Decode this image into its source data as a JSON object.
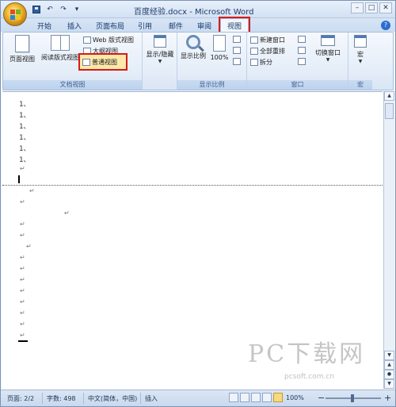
{
  "window": {
    "title": "百度经验.docx - Microsoft Word",
    "controls": [
      "–",
      "□",
      "✕"
    ]
  },
  "qat": {
    "icons": [
      "save-icon",
      "undo-icon",
      "redo-icon",
      "customize-icon"
    ],
    "undo_glyph": "↶",
    "redo_glyph": "↷",
    "more_glyph": "▾"
  },
  "tabs": [
    "开始",
    "插入",
    "页面布局",
    "引用",
    "邮件",
    "审阅",
    "视图"
  ],
  "active_tab": "视图",
  "accent": {
    "highlight_red": "#d81a1a",
    "ribbon_blue": "#c9dbf1"
  },
  "ribbon": {
    "doc_views": {
      "label": "文档视图",
      "page_view": "页面视图",
      "reading_view": "阅读版式视图",
      "web_view": "Web 版式视图",
      "outline_view": "大纲视图",
      "normal_view": "普通视图"
    },
    "show_hide": {
      "label": "显示/隐藏"
    },
    "zoom": {
      "label": "显示比例",
      "zoom_btn": "显示比例",
      "zoom_100": "100%"
    },
    "window": {
      "label": "窗口",
      "new_window": "新建窗口",
      "arrange_all": "全部重排",
      "split": "拆分",
      "switch_windows": "切换窗口"
    },
    "macros": {
      "label": "宏",
      "macro_btn": "宏"
    }
  },
  "document": {
    "lines": [
      "1、",
      "1、",
      "1、",
      "1、",
      "1、",
      "1、"
    ],
    "para_mark": "↵"
  },
  "watermark": {
    "text": "PC下载网",
    "sub": "pcsoft.com.cn"
  },
  "status": {
    "page": "页面: 2/2",
    "words": "字数: 498",
    "language": "中文(简体，中国)",
    "mode": "插入",
    "zoom": "100%",
    "zoom_minus": "−",
    "zoom_plus": "+"
  },
  "scrollbar": {
    "up": "▲",
    "down": "▼",
    "prev_page": "▲",
    "next_page": "▼",
    "browse": "●"
  }
}
